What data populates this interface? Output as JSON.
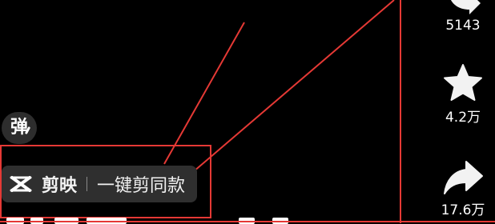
{
  "overlay": {
    "danmaku_label": "弹",
    "capcut": {
      "brand": "剪映",
      "action": "一键剪同款"
    }
  },
  "rail": {
    "share_count": "5143",
    "favorite_count": "4.2万",
    "forward_count": "17.6万"
  },
  "colors": {
    "annotation": "#e53935",
    "pill_bg": "#2f2f2f"
  },
  "icons": [
    "danmaku-icon",
    "capcut-icon",
    "share-icon",
    "star-icon",
    "forward-icon"
  ]
}
